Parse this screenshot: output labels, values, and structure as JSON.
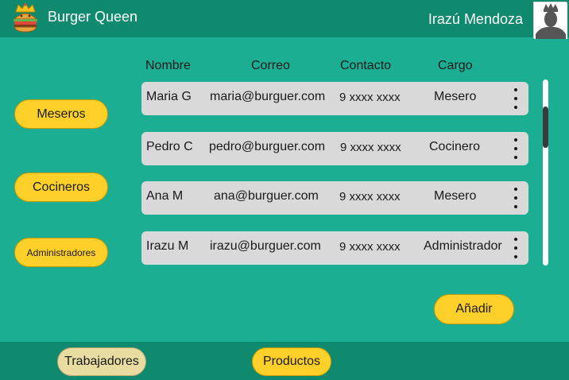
{
  "header": {
    "brand": "Burger Queen",
    "user_name": "Irazú Mendoza",
    "logo_icon": "burger-crown-icon",
    "avatar_icon": "user-crown-avatar-icon"
  },
  "table": {
    "columns": [
      "Nombre",
      "Correo",
      "Contacto",
      "Cargo"
    ],
    "rows": [
      {
        "nombre": "Maria G",
        "correo": "maria@burguer.com",
        "contacto": "9 xxxx xxxx",
        "cargo": "Mesero"
      },
      {
        "nombre": "Pedro C",
        "correo": "pedro@burguer.com",
        "contacto": "9 xxxx xxxx",
        "cargo": "Cocinero"
      },
      {
        "nombre": "Ana M",
        "correo": "ana@burguer.com",
        "contacto": "9 xxxx xxxx",
        "cargo": "Mesero"
      },
      {
        "nombre": "Irazu M",
        "correo": "irazu@burguer.com",
        "contacto": "9 xxxx xxxx",
        "cargo": "Administrador"
      }
    ]
  },
  "sidebar": {
    "filters": [
      "Meseros",
      "Cocineros",
      "Administradores"
    ]
  },
  "actions": {
    "add_label": "Añadir"
  },
  "bottom_nav": {
    "tabs": [
      "Trabajadores",
      "Productos"
    ]
  },
  "colors": {
    "background": "#1cae93",
    "bars": "#0f8a6e",
    "accent_yellow": "#ffd02a",
    "row_gray": "#d9d9d9",
    "active_tab": "#e8dca0"
  }
}
